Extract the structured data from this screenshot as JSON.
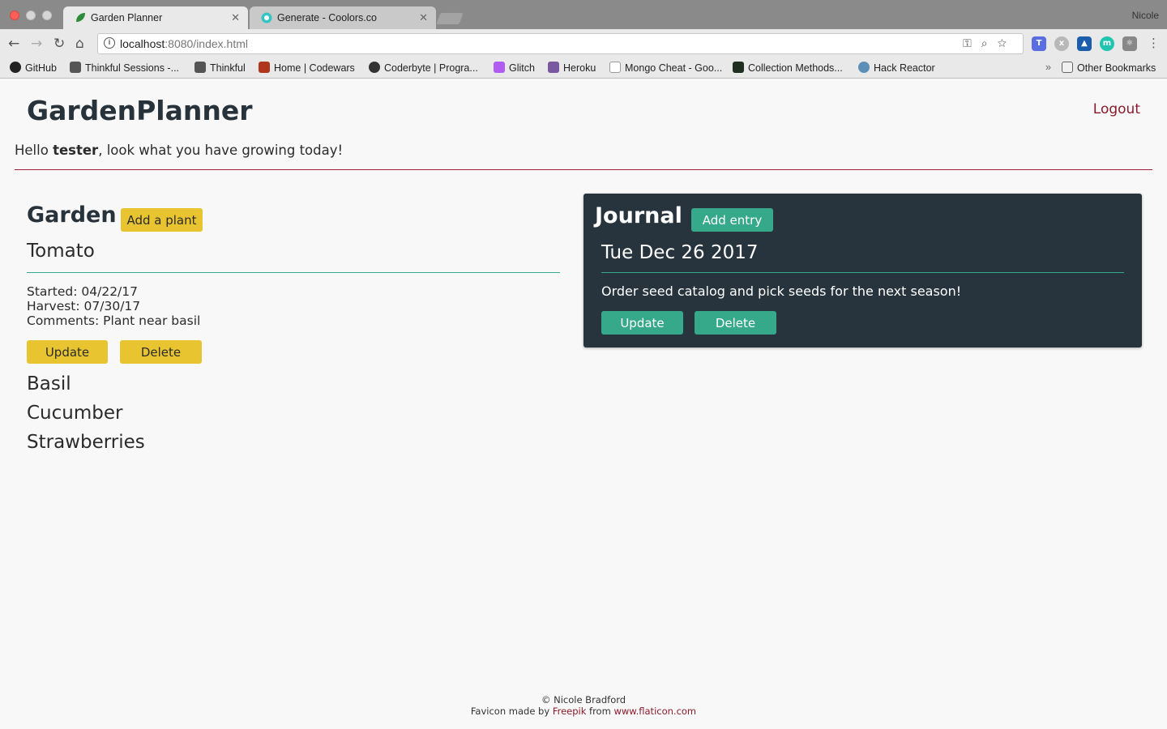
{
  "browser": {
    "tabs": [
      {
        "title": "Garden Planner",
        "active": true
      },
      {
        "title": "Generate - Coolors.co",
        "active": false
      }
    ],
    "profile_name": "Nicole",
    "url_host": "localhost",
    "url_path": ":8080/index.html",
    "bookmarks": [
      {
        "label": "GitHub",
        "color": "#222222"
      },
      {
        "label": "Thinkful Sessions -...",
        "color": "#444444"
      },
      {
        "label": "Thinkful",
        "color": "#444444"
      },
      {
        "label": "Home | Codewars",
        "color": "#b1361e"
      },
      {
        "label": "Coderbyte | Progra...",
        "color": "#333333"
      },
      {
        "label": "Glitch",
        "color": "#b05cf0"
      },
      {
        "label": "Heroku",
        "color": "#79589f"
      },
      {
        "label": "Mongo Cheat - Goo...",
        "color": "#cccccc"
      },
      {
        "label": "Collection Methods...",
        "color": "#3f9b3f"
      },
      {
        "label": "Hack Reactor",
        "color": "#5c8fb8"
      }
    ],
    "other_bookmarks": "Other Bookmarks"
  },
  "header": {
    "brand": "GardenPlanner",
    "logout": "Logout"
  },
  "greeting": {
    "prefix": "Hello ",
    "username": "tester",
    "suffix": ", look what you have growing today!"
  },
  "garden": {
    "title": "Garden",
    "add_button": "Add a plant",
    "expanded_plant": {
      "name": "Tomato",
      "started": "Started: 04/22/17",
      "harvest": "Harvest: 07/30/17",
      "comments": "Comments: Plant near basil",
      "update_label": "Update",
      "delete_label": "Delete"
    },
    "other_plants": [
      "Basil",
      "Cucumber",
      "Strawberries"
    ]
  },
  "journal": {
    "title": "Journal",
    "add_button": "Add entry",
    "entry": {
      "date": "Tue Dec 26 2017",
      "text": "Order seed catalog and pick seeds for the next season!",
      "update_label": "Update",
      "delete_label": "Delete"
    }
  },
  "footer": {
    "copyright": "© Nicole Bradford",
    "favicon_prefix": "Favicon made by ",
    "author_link": "Freepik",
    "from_text": " from ",
    "site_link": "www.flaticon.com"
  },
  "colors": {
    "accent_yellow": "#e8c530",
    "accent_teal": "#36a98b",
    "journal_bg": "#27343d",
    "divider_red": "#a02238"
  }
}
